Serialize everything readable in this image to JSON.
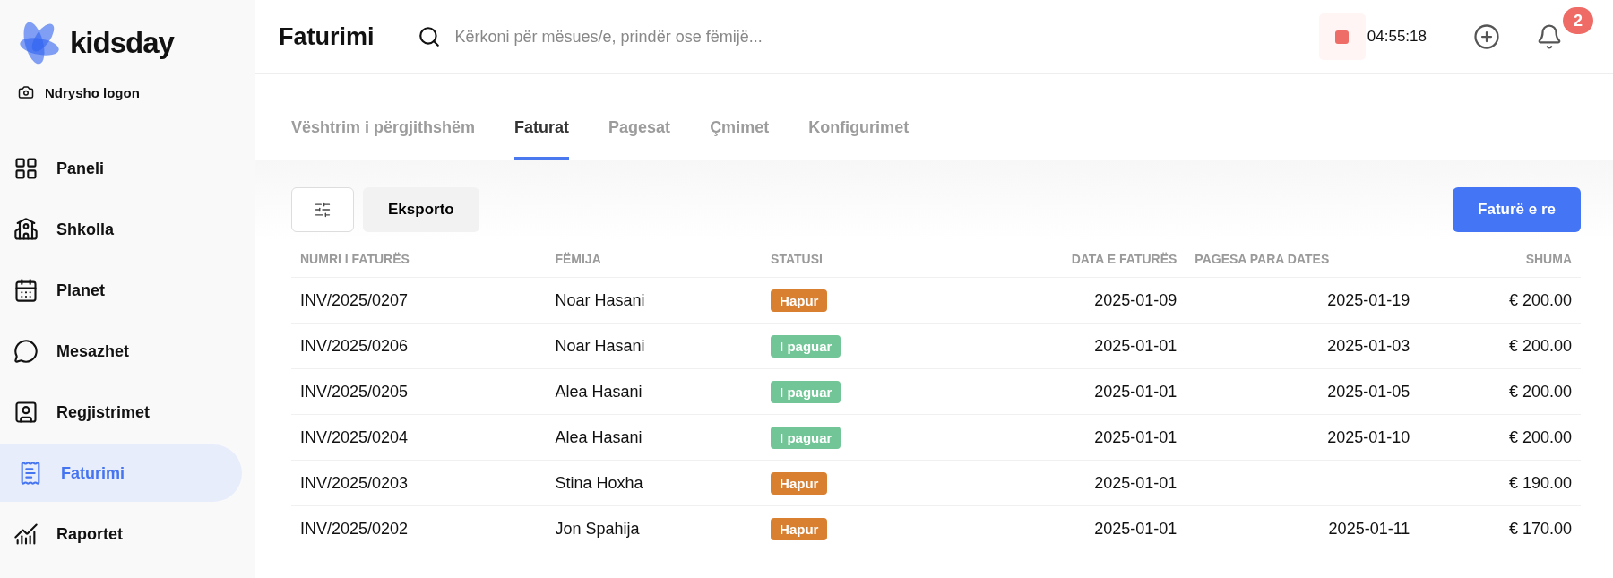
{
  "brand": {
    "name": "kidsday",
    "change_logo": "Ndrysho logon"
  },
  "sidebar": {
    "items": [
      {
        "label": "Paneli",
        "selected": false
      },
      {
        "label": "Shkolla",
        "selected": false
      },
      {
        "label": "Planet",
        "selected": false
      },
      {
        "label": "Mesazhet",
        "selected": false
      },
      {
        "label": "Regjistrimet",
        "selected": false
      },
      {
        "label": "Faturimi",
        "selected": true
      },
      {
        "label": "Raportet",
        "selected": false
      }
    ]
  },
  "header": {
    "title": "Faturimi",
    "search": {
      "placeholder": "Kërkoni për mësues/e, prindër ose fëmijë..."
    },
    "timer": "04:55:18",
    "notifications": "2"
  },
  "tabs": [
    {
      "label": "Vështrim i përgjithshëm",
      "selected": false
    },
    {
      "label": "Faturat",
      "selected": true
    },
    {
      "label": "Pagesat",
      "selected": false
    },
    {
      "label": "Çmimet",
      "selected": false
    },
    {
      "label": "Konfigurimet",
      "selected": false
    }
  ],
  "toolbar": {
    "export": "Eksporto",
    "new_invoice": "Faturë e re"
  },
  "table": {
    "columns": [
      "NUMRI I FATURËS",
      "FËMIJA",
      "STATUSI",
      "DATA E FATURËS",
      "PAGESA PARA DATES",
      "SHUMA"
    ],
    "rows": [
      {
        "number": "INV/2025/0207",
        "child": "Noar Hasani",
        "status": {
          "label": "Hapur",
          "kind": "open"
        },
        "date": "2025-01-09",
        "due_date": "2025-01-19",
        "amount": "€ 200.00"
      },
      {
        "number": "INV/2025/0206",
        "child": "Noar Hasani",
        "status": {
          "label": "I paguar",
          "kind": "paid"
        },
        "date": "2025-01-01",
        "due_date": "2025-01-03",
        "amount": "€ 200.00"
      },
      {
        "number": "INV/2025/0205",
        "child": "Alea Hasani",
        "status": {
          "label": "I paguar",
          "kind": "paid"
        },
        "date": "2025-01-01",
        "due_date": "2025-01-05",
        "amount": "€ 200.00"
      },
      {
        "number": "INV/2025/0204",
        "child": "Alea Hasani",
        "status": {
          "label": "I paguar",
          "kind": "paid"
        },
        "date": "2025-01-01",
        "due_date": "2025-01-10",
        "amount": "€ 200.00"
      },
      {
        "number": "INV/2025/0203",
        "child": "Stina Hoxha",
        "status": {
          "label": "Hapur",
          "kind": "open"
        },
        "date": "2025-01-01",
        "amount": "€ 190.00"
      },
      {
        "number": "INV/2025/0202",
        "child": "Jon Spahija",
        "status": {
          "label": "Hapur",
          "kind": "open"
        },
        "date": "2025-01-01",
        "due_date": "2025-01-11",
        "amount": "€ 170.00"
      }
    ]
  }
}
